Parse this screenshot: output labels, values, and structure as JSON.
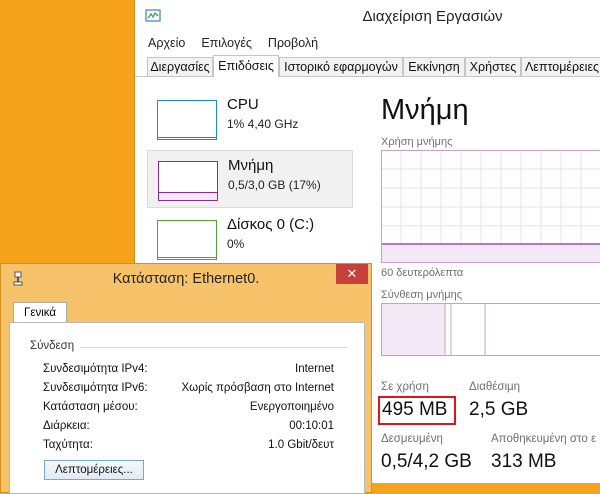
{
  "task_manager": {
    "title": "Διαχείριση Εργασιών",
    "menu": [
      "Αρχείο",
      "Επιλογές",
      "Προβολή"
    ],
    "tabs": [
      "Διεργασίες",
      "Επιδόσεις",
      "Ιστορικό εφαρμογών",
      "Εκκίνηση",
      "Χρήστες",
      "Λεπτομέρειες"
    ],
    "active_tab": "Επιδόσεις",
    "perf_items": [
      {
        "name": "CPU",
        "sub": "1% 4,40 GHz",
        "color": "#1b8fc4"
      },
      {
        "name": "Μνήμη",
        "sub": "0,5/3,0 GB (17%)",
        "color": "#8b27a8"
      },
      {
        "name": "Δίσκος 0 (C:)",
        "sub": "0%",
        "color": "#4da531"
      }
    ],
    "memory": {
      "heading": "Μνήμη",
      "usage_label": "Χρήση μνήμης",
      "time_label": "60 δευτερόλεπτα",
      "composition_label": "Σύνθεση μνήμης",
      "in_use_label": "Σε χρήση",
      "in_use_value": "495 MB",
      "available_label": "Διαθέσιμη",
      "available_value": "2,5 GB",
      "committed_label": "Δεσμευμένη",
      "committed_value": "0,5/4,2 GB",
      "cached_label": "Αποθηκευμένη στο ε",
      "cached_value": "313 MB"
    },
    "accent_color": "#8b27a8"
  },
  "ethernet_dialog": {
    "title": "Κατάσταση: Ethernet0.",
    "close_glyph": "✕",
    "tab": "Γενικά",
    "section": "Σύνδεση",
    "rows": [
      {
        "label": "Συνδεσιμότητα IPv4:",
        "value": "Internet"
      },
      {
        "label": "Συνδεσιμότητα IPv6:",
        "value": "Χωρίς πρόσβαση στο Internet"
      },
      {
        "label": "Κατάσταση μέσου:",
        "value": "Ενεργοποιημένο"
      },
      {
        "label": "Διάρκεια:",
        "value": "00:10:01"
      },
      {
        "label": "Ταχύτητα:",
        "value": "1.0 Gbit/δευτ"
      }
    ],
    "details_button": "Λεπτομέρειες..."
  }
}
